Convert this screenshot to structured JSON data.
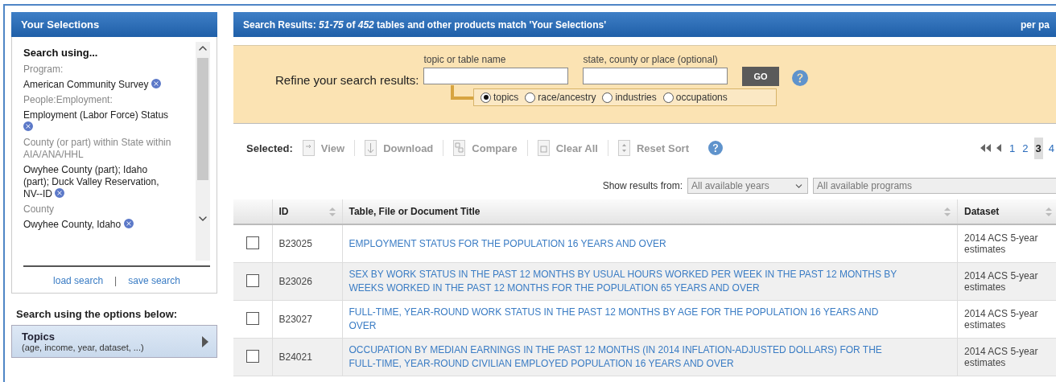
{
  "selections": {
    "title": "Your Selections",
    "heading": "Search using...",
    "items": [
      {
        "label": "Program:",
        "value": "American Community Survey"
      },
      {
        "label": "People:Employment:",
        "value": "Employment (Labor Force) Status"
      },
      {
        "label": "County (or part) within State within AIA/ANA/HHL",
        "value": "Owyhee County (part); Idaho (part); Duck Valley Reservation, NV--ID"
      },
      {
        "label": "County",
        "value": "Owyhee County, Idaho"
      }
    ],
    "links": [
      "load search",
      "save search"
    ],
    "separator": "|"
  },
  "options": {
    "title": "Search using the options below:",
    "topics": {
      "title": "Topics",
      "subtitle": "(age, income, year, dataset, ...)"
    }
  },
  "results": {
    "header": "Search Results: *51-75* of *452* tables and other products match 'Your Selections'",
    "per_page": "per pa",
    "refine": {
      "label": "Refine your search results:",
      "fields": [
        {
          "label": "topic or table name"
        },
        {
          "label": "state, county or place (optional)"
        }
      ],
      "go": "GO",
      "radios": [
        {
          "label": "topics",
          "selected": true
        },
        {
          "label": "race/ancestry",
          "selected": false
        },
        {
          "label": "industries",
          "selected": false
        },
        {
          "label": "occupations",
          "selected": false
        }
      ]
    },
    "toolbar": {
      "label": "Selected:",
      "actions": [
        {
          "kind": "view",
          "label": "View",
          "disabled": true
        },
        {
          "kind": "download",
          "label": "Download",
          "disabled": true
        },
        {
          "kind": "compare",
          "label": "Compare",
          "disabled": true
        },
        {
          "kind": "clear",
          "label": "Clear All",
          "disabled": true
        },
        {
          "kind": "sort",
          "label": "Reset Sort",
          "disabled": true
        }
      ]
    },
    "pages": [
      {
        "label": "1",
        "selected": false
      },
      {
        "label": "2",
        "selected": false
      },
      {
        "label": "3",
        "selected": true
      },
      {
        "label": "4",
        "selected": false
      }
    ],
    "filters": {
      "label": "Show results from:",
      "selects": [
        "All available years",
        "All available programs"
      ]
    },
    "table": {
      "columns": [
        "ID",
        "Table, File or Document Title",
        "Dataset"
      ],
      "rows": [
        {
          "checked": false,
          "id": "B23025",
          "title": "EMPLOYMENT STATUS FOR THE POPULATION 16 YEARS AND OVER",
          "dataset": "2014 ACS 5-year estimates"
        },
        {
          "checked": false,
          "id": "B23026",
          "title": "SEX BY WORK STATUS IN THE PAST 12 MONTHS BY USUAL HOURS WORKED PER WEEK IN THE PAST 12 MONTHS BY WEEKS WORKED IN THE PAST 12 MONTHS FOR THE POPULATION 65 YEARS AND OVER",
          "dataset": "2014 ACS 5-year estimates"
        },
        {
          "checked": false,
          "id": "B23027",
          "title": "FULL-TIME, YEAR-ROUND WORK STATUS IN THE PAST 12 MONTHS BY AGE FOR THE POPULATION 16 YEARS AND OVER",
          "dataset": "2014 ACS 5-year estimates"
        },
        {
          "checked": false,
          "id": "B24021",
          "title": "OCCUPATION BY MEDIAN EARNINGS IN THE PAST 12 MONTHS (IN 2014 INFLATION-ADJUSTED DOLLARS) FOR THE FULL-TIME, YEAR-ROUND CIVILIAN EMPLOYED POPULATION 16 YEARS AND OVER",
          "dataset": "2014 ACS 5-year estimates"
        }
      ]
    }
  }
}
